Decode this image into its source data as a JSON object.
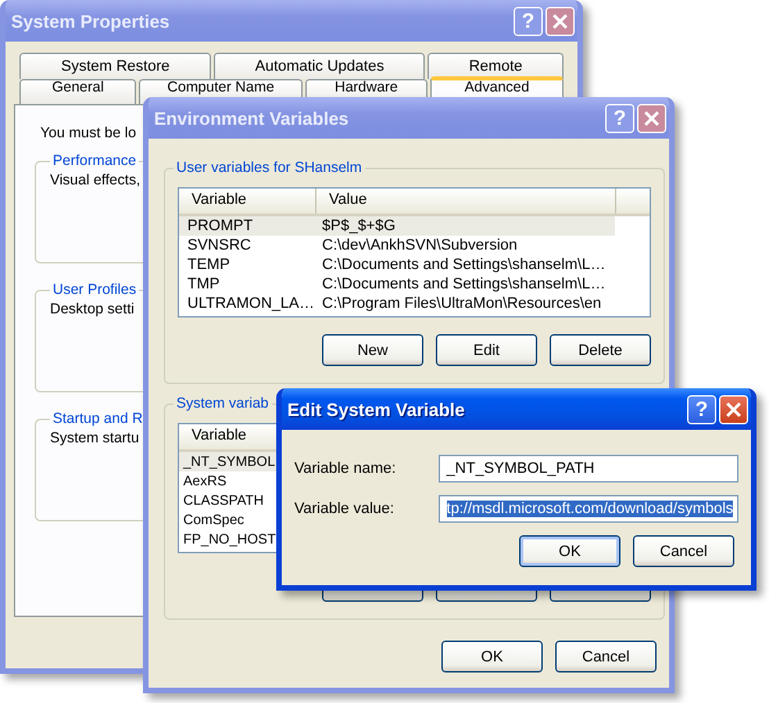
{
  "system_properties": {
    "title": "System Properties",
    "active": false,
    "help": "?",
    "tab_rows": [
      [
        {
          "label": "System Restore",
          "selected": false
        },
        {
          "label": "Automatic Updates",
          "selected": false
        },
        {
          "label": "Remote",
          "selected": false
        }
      ],
      [
        {
          "label": "General",
          "selected": false
        },
        {
          "label": "Computer Name",
          "selected": false
        },
        {
          "label": "Hardware",
          "selected": false
        },
        {
          "label": "Advanced",
          "selected": true
        }
      ]
    ],
    "intro": "You must be lo",
    "groups": [
      {
        "title": "Performance",
        "text": "Visual effects,"
      },
      {
        "title": "User Profiles",
        "text": "Desktop setti"
      },
      {
        "title": "Startup and R",
        "text": "System startu"
      }
    ]
  },
  "environment_variables": {
    "title": "Environment Variables",
    "active": false,
    "help": "?",
    "sections": [
      {
        "title": "User variables for SHanselm",
        "columns": [
          "Variable",
          "Value"
        ],
        "rows": [
          {
            "cells": [
              "PROMPT",
              "$P$_$+$G"
            ],
            "selected": true
          },
          {
            "cells": [
              "SVNSRC",
              "C:\\dev\\AnkhSVN\\Subversion"
            ],
            "selected": false
          },
          {
            "cells": [
              "TEMP",
              "C:\\Documents and Settings\\shanselm\\L…"
            ],
            "selected": false
          },
          {
            "cells": [
              "TMP",
              "C:\\Documents and Settings\\shanselm\\L…"
            ],
            "selected": false
          },
          {
            "cells": [
              "ULTRAMON_LA…",
              "C:\\Program Files\\UltraMon\\Resources\\en"
            ],
            "selected": false
          }
        ],
        "buttons": [
          "New",
          "Edit",
          "Delete"
        ]
      },
      {
        "title": "System variab",
        "columns": [
          "Variable"
        ],
        "rows": [
          {
            "cells": [
              "_NT_SYMBOL"
            ],
            "selected": true
          },
          {
            "cells": [
              "AexRS"
            ],
            "selected": false
          },
          {
            "cells": [
              "CLASSPATH"
            ],
            "selected": false
          },
          {
            "cells": [
              "ComSpec"
            ],
            "selected": false
          },
          {
            "cells": [
              "FP_NO_HOST"
            ],
            "selected": false
          }
        ]
      }
    ],
    "buttons": [
      "OK",
      "Cancel"
    ]
  },
  "edit_system_variable": {
    "title": "Edit System Variable",
    "active": true,
    "help": "?",
    "fields": [
      {
        "label": "Variable name:",
        "value": "_NT_SYMBOL_PATH",
        "selected": false
      },
      {
        "label": "Variable value:",
        "value": "tp://msdl.microsoft.com/download/symbols",
        "selected": true
      }
    ],
    "buttons": [
      {
        "label": "OK",
        "default": true
      },
      {
        "label": "Cancel",
        "default": false
      }
    ]
  }
}
